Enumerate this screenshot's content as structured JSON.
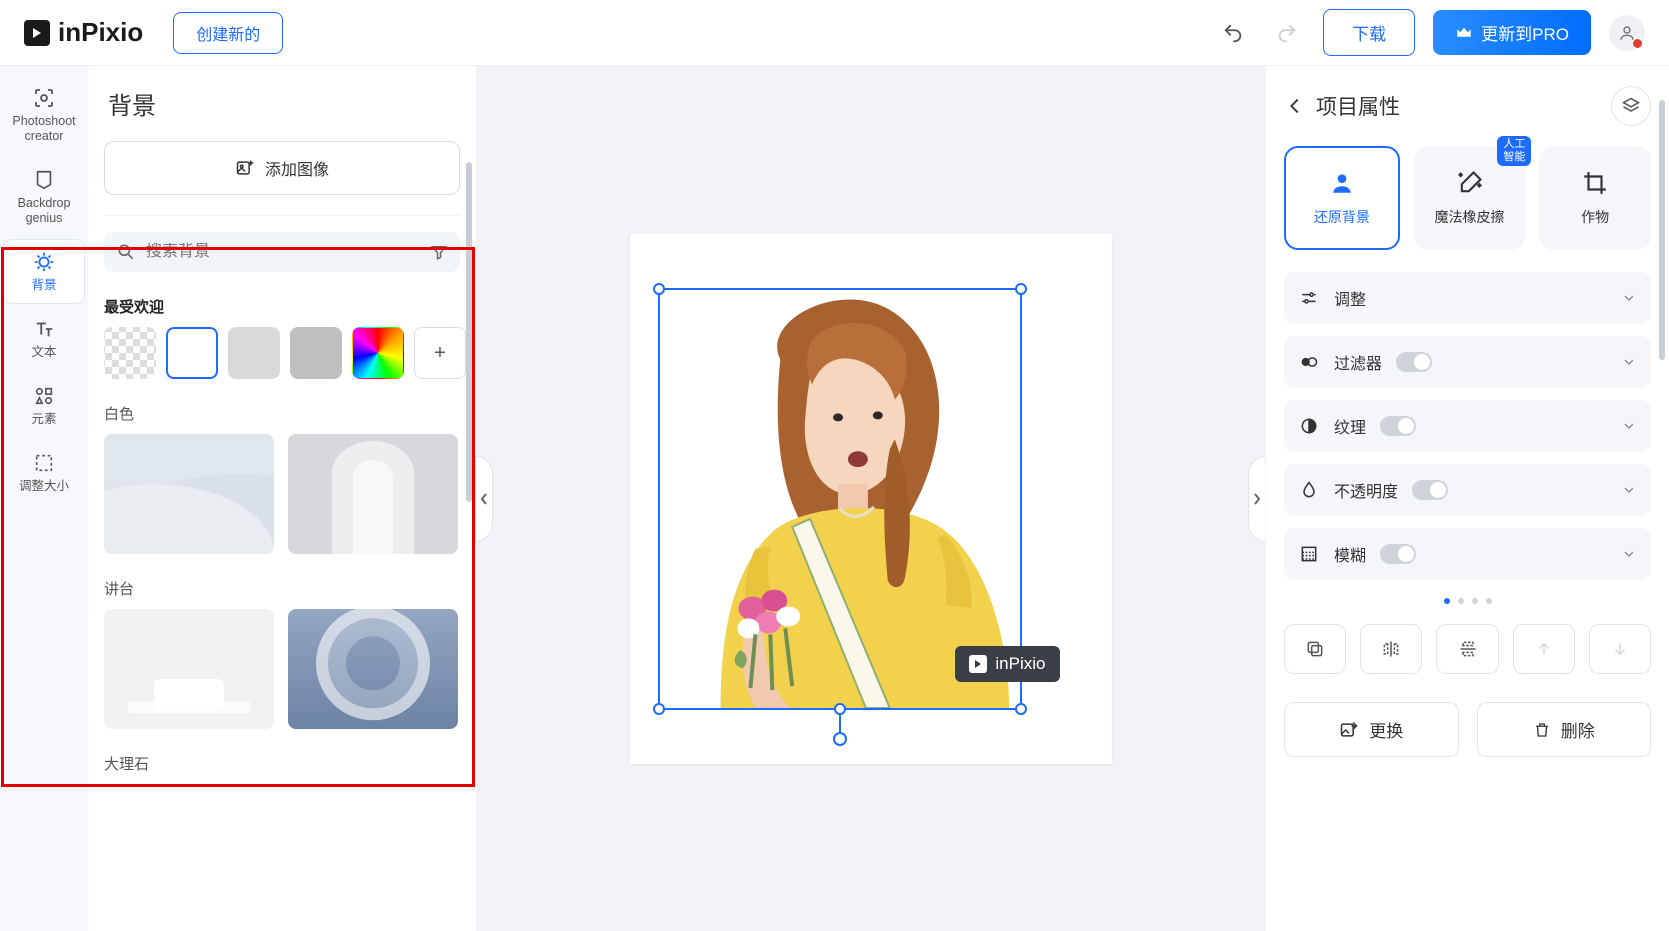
{
  "brand": "inPixio",
  "top": {
    "create_new": "创建新的",
    "download": "下载",
    "upgrade": "更新到PRO"
  },
  "nav": {
    "items": [
      {
        "id": "photoshoot-creator",
        "label": "Photoshoot\ncreator"
      },
      {
        "id": "backdrop-genius",
        "label": "Backdrop\ngenius"
      },
      {
        "id": "background",
        "label": "背景"
      },
      {
        "id": "text",
        "label": "文本"
      },
      {
        "id": "elements",
        "label": "元素"
      },
      {
        "id": "resize",
        "label": "调整大小"
      }
    ]
  },
  "left": {
    "title": "背景",
    "add_image": "添加图像",
    "search_placeholder": "搜索背景",
    "section_popular": "最受欢迎",
    "section_white": "白色",
    "section_podium": "讲台",
    "section_marble": "大理石"
  },
  "watermark": "inPixio",
  "right": {
    "title": "项目属性",
    "tools": [
      {
        "id": "restore-bg",
        "label": "还原背景",
        "active": true
      },
      {
        "id": "magic-eraser",
        "label": "魔法橡皮擦",
        "badge": "人工\n智能"
      },
      {
        "id": "crop",
        "label": "作物"
      }
    ],
    "acc": [
      {
        "id": "adjust",
        "label": "调整",
        "toggle": false
      },
      {
        "id": "filter",
        "label": "过滤器",
        "toggle": true
      },
      {
        "id": "texture",
        "label": "纹理",
        "toggle": true
      },
      {
        "id": "opacity",
        "label": "不透明度",
        "toggle": true
      },
      {
        "id": "blur",
        "label": "模糊",
        "toggle": true
      }
    ],
    "replace": "更换",
    "delete": "删除"
  }
}
